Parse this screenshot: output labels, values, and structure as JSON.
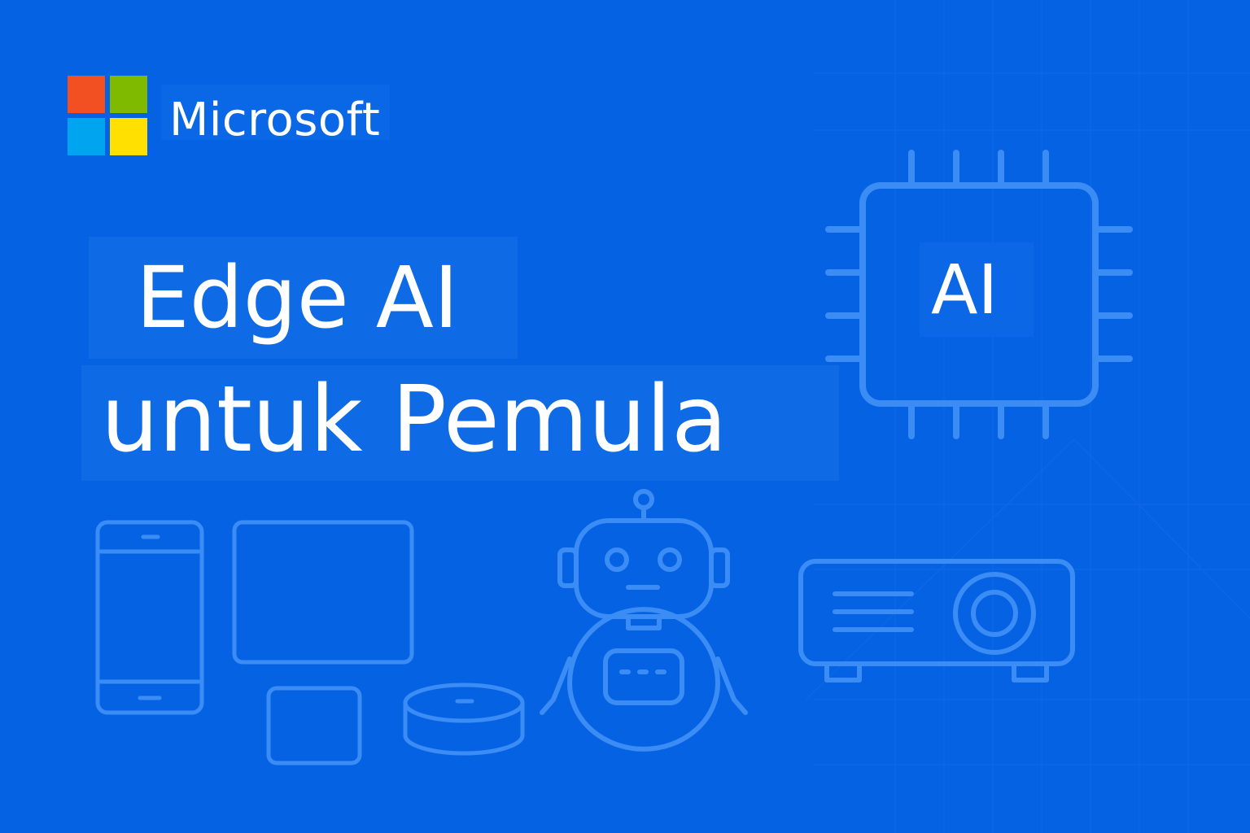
{
  "brand": {
    "name": "Microsoft",
    "colors": {
      "red": "#f25022",
      "green": "#7fba00",
      "blue": "#00a4ef",
      "yellow": "#ffe000"
    }
  },
  "title": {
    "line1": "Edge AI",
    "line2": "untuk Pemula"
  },
  "chip": {
    "label": "AI"
  },
  "illustrations": {
    "icons": [
      "chip-icon",
      "phone-icon",
      "tablet-icon",
      "small-device-icon",
      "smart-speaker-icon",
      "robot-icon",
      "projector-icon"
    ]
  },
  "theme": {
    "background": "#0563e3",
    "line_color": "#3b8cf5",
    "text_color": "#ffffff"
  }
}
